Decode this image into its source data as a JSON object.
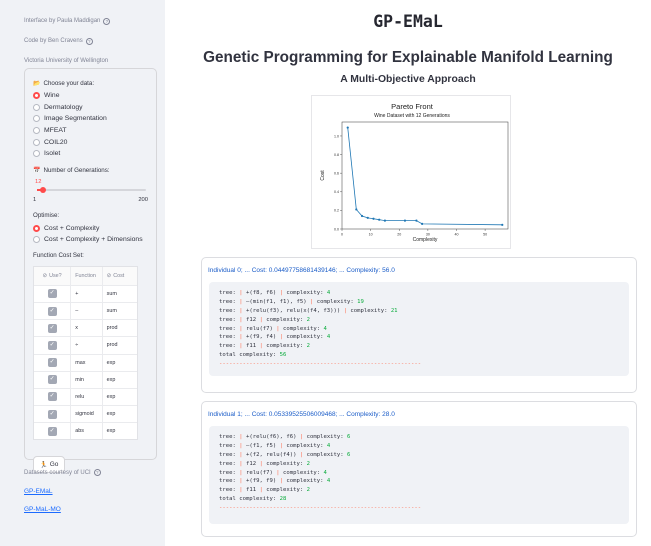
{
  "sidebar": {
    "interface_by": "Interface by Paula Maddigan",
    "code_by": "Code by Ben Cravens",
    "university": "Victoria University of Wellington",
    "data_label": "Choose your data:",
    "datasets": [
      {
        "label": "Wine",
        "selected": true
      },
      {
        "label": "Dermatology",
        "selected": false
      },
      {
        "label": "Image Segmentation",
        "selected": false
      },
      {
        "label": "MFEAT",
        "selected": false
      },
      {
        "label": "COIL20",
        "selected": false
      },
      {
        "label": "Isolet",
        "selected": false
      }
    ],
    "generations_label": "Number of Generations:",
    "generations_value": "12",
    "generations_fraction": 0.055,
    "generations_min": "1",
    "generations_max": "200",
    "optimise_label": "Optimise:",
    "optimise_options": [
      {
        "label": "Cost + Complexity",
        "selected": true
      },
      {
        "label": "Cost + Complexity + Dimensions",
        "selected": false
      }
    ],
    "function_cost_label": "Function Cost Set:",
    "table_headers": {
      "use": "Use?",
      "function": "Function",
      "cost": "Cost"
    },
    "functions": [
      {
        "name": "+",
        "cost": "sum"
      },
      {
        "name": "–",
        "cost": "sum"
      },
      {
        "name": "x",
        "cost": "prod"
      },
      {
        "name": "÷",
        "cost": "prod"
      },
      {
        "name": "max",
        "cost": "exp"
      },
      {
        "name": "min",
        "cost": "exp"
      },
      {
        "name": "relu",
        "cost": "exp"
      },
      {
        "name": "sigmoid",
        "cost": "exp"
      },
      {
        "name": "abs",
        "cost": "exp"
      }
    ],
    "go_label": "Go",
    "courtesy": "Datasets courtesy of UCI",
    "links": [
      "GP-EMaL",
      "GP-MaL-MO"
    ]
  },
  "main": {
    "title": "GP-EMaL",
    "subtitle": "Genetic Programming for Explainable Manifold Learning",
    "subsubtitle": "A Multi-Objective Approach",
    "individuals": [
      {
        "header": "Individual 0; ... Cost: 0.04497758681439146; ... Complexity: 56.0",
        "lines": [
          {
            "expr": "+(f8, f6)",
            "complexity": "4"
          },
          {
            "expr": "–(min(f1, f1), f5)",
            "complexity": "19"
          },
          {
            "expr": "+(relu(f3), relu(x(f4, f3)))",
            "complexity": "21"
          },
          {
            "expr": "f12",
            "complexity": "2"
          },
          {
            "expr": "relu(f7)",
            "complexity": "4"
          },
          {
            "expr": "+(f9, f4)",
            "complexity": "4"
          },
          {
            "expr": "f11",
            "complexity": "2"
          }
        ],
        "total": "56"
      },
      {
        "header": "Individual 1; ... Cost: 0.05339525506009468; ... Complexity: 28.0",
        "lines": [
          {
            "expr": "+(relu(f6), f6)",
            "complexity": "6"
          },
          {
            "expr": "–(f1, f5)",
            "complexity": "4"
          },
          {
            "expr": "+(f2, relu(f4))",
            "complexity": "6"
          },
          {
            "expr": "f12",
            "complexity": "2"
          },
          {
            "expr": "relu(f7)",
            "complexity": "4"
          },
          {
            "expr": "+(f9, f9)",
            "complexity": "4"
          },
          {
            "expr": "f11",
            "complexity": "2"
          }
        ],
        "total": "28"
      }
    ],
    "tree_prefix": "tree:",
    "complexity_prefix": "complexity:",
    "total_prefix": "total complexity:"
  },
  "chart_data": {
    "type": "line",
    "title": "Pareto Front",
    "subtitle": "Wine Dataset with 12 Generations",
    "xlabel": "Complexity",
    "ylabel": "Cost",
    "xlim": [
      0,
      58
    ],
    "ylim": [
      0,
      1.15
    ],
    "x_ticks": [
      "0",
      "10",
      "20",
      "30",
      "40",
      "50"
    ],
    "y_ticks": [
      "0.0",
      "0.2",
      "0.4",
      "0.6",
      "0.8",
      "1.0"
    ],
    "series": [
      {
        "x": [
          2,
          5,
          7,
          9,
          11,
          13,
          15,
          22,
          26,
          28,
          56
        ],
        "y": [
          1.09,
          0.21,
          0.14,
          0.12,
          0.11,
          0.1,
          0.09,
          0.09,
          0.09,
          0.055,
          0.045
        ]
      }
    ],
    "color": "#1f77b4",
    "grid": false
  }
}
